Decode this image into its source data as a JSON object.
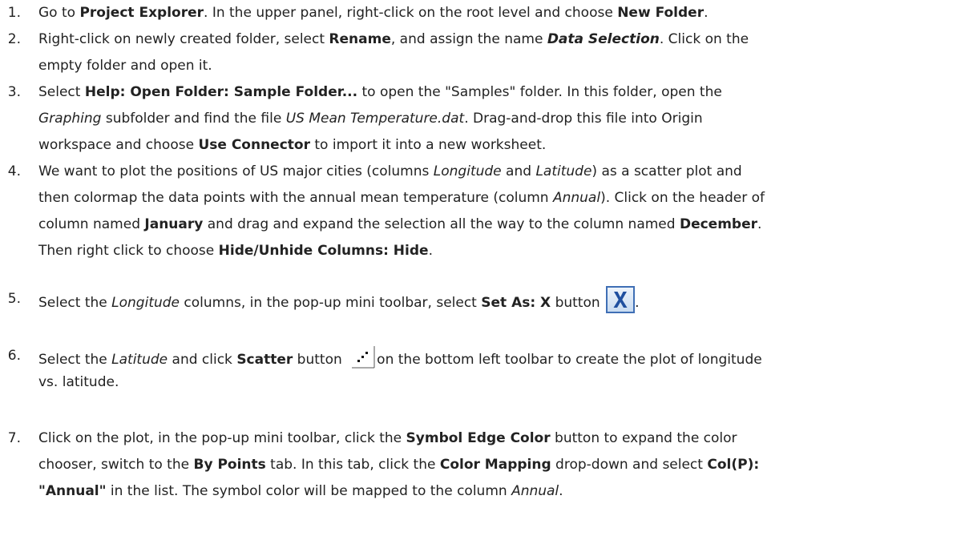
{
  "steps": [
    {
      "num": "1.",
      "lines": [
        [
          {
            "t": "Go to "
          },
          {
            "t": "Project Explorer",
            "b": true
          },
          {
            "t": ". In the upper panel, right-click on the root level and choose "
          },
          {
            "t": "New Folder",
            "b": true
          },
          {
            "t": "."
          }
        ]
      ]
    },
    {
      "num": "2.",
      "lines": [
        [
          {
            "t": "Right-click on newly created folder, select "
          },
          {
            "t": "Rename",
            "b": true
          },
          {
            "t": ", and assign the name "
          },
          {
            "t": "Data Selection",
            "b": true,
            "i": true
          },
          {
            "t": ". Click on the"
          }
        ],
        [
          {
            "t": "empty folder and open it."
          }
        ]
      ]
    },
    {
      "num": "3.",
      "lines": [
        [
          {
            "t": "Select "
          },
          {
            "t": "Help: Open Folder: Sample Folder...",
            "b": true
          },
          {
            "t": " to open the \"Samples\" folder. In this folder, open the"
          }
        ],
        [
          {
            "t": "Graphing",
            "i": true
          },
          {
            "t": " subfolder and find the file "
          },
          {
            "t": "US Mean Temperature.dat",
            "i": true
          },
          {
            "t": ". Drag-and-drop this file into Origin"
          }
        ],
        [
          {
            "t": "workspace and choose "
          },
          {
            "t": "Use Connector",
            "b": true
          },
          {
            "t": " to import it into a new worksheet."
          }
        ]
      ]
    },
    {
      "num": "4.",
      "lines": [
        [
          {
            "t": "We want to plot the positions of US major cities (columns "
          },
          {
            "t": "Longitude",
            "i": true
          },
          {
            "t": " and "
          },
          {
            "t": "Latitude",
            "i": true
          },
          {
            "t": ") as a scatter plot and"
          }
        ],
        [
          {
            "t": "then colormap the data points with the annual mean temperature (column "
          },
          {
            "t": "Annual",
            "i": true
          },
          {
            "t": "). Click on the header of"
          }
        ],
        [
          {
            "t": "column named "
          },
          {
            "t": "January",
            "b": true
          },
          {
            "t": " and drag and expand the selection all the way to the column named "
          },
          {
            "t": "December",
            "b": true
          },
          {
            "t": "."
          }
        ],
        [
          {
            "t": "Then right click to choose "
          },
          {
            "t": "Hide/Unhide Columns: Hide",
            "b": true
          },
          {
            "t": "."
          }
        ]
      ]
    },
    {
      "num": "5.",
      "lines": [
        [
          {
            "t": "Select the "
          },
          {
            "t": "Longitude",
            "i": true
          },
          {
            "t": " columns, in the pop-up mini toolbar, select "
          },
          {
            "t": "Set As: X",
            "b": true
          },
          {
            "t": " button "
          },
          {
            "icon": "set-as-x-icon"
          },
          {
            "t": "."
          }
        ]
      ]
    },
    {
      "num": "6.",
      "lines": [
        [
          {
            "t": "Select the "
          },
          {
            "t": "Latitude",
            "i": true
          },
          {
            "t": " and click "
          },
          {
            "t": "Scatter",
            "b": true
          },
          {
            "t": " button "
          },
          {
            "icon": "scatter-plot-icon"
          },
          {
            "t": "on the bottom left toolbar to create the plot of longitude"
          }
        ],
        [
          {
            "t": "vs. latitude."
          }
        ]
      ]
    },
    {
      "num": "7.",
      "lines": [
        [
          {
            "t": "Click on the plot, in the pop-up mini toolbar, click the "
          },
          {
            "t": "Symbol Edge Color",
            "b": true
          },
          {
            "t": " button to expand the color"
          }
        ],
        [
          {
            "t": "chooser, switch to the "
          },
          {
            "t": "By Points",
            "b": true
          },
          {
            "t": " tab. In this tab, click the "
          },
          {
            "t": "Color Mapping",
            "b": true
          },
          {
            "t": " drop-down and select "
          },
          {
            "t": "Col(P):",
            "b": true
          }
        ],
        [
          {
            "t": "\"Annual\"",
            "b": true
          },
          {
            "t": " in the list. The symbol color will be mapped to the column "
          },
          {
            "t": "Annual",
            "i": true
          },
          {
            "t": "."
          }
        ]
      ]
    }
  ],
  "colors": {
    "text": "#222222",
    "x_icon_border": "#3f6fb5",
    "x_icon_letter": "#1f4f9f"
  }
}
